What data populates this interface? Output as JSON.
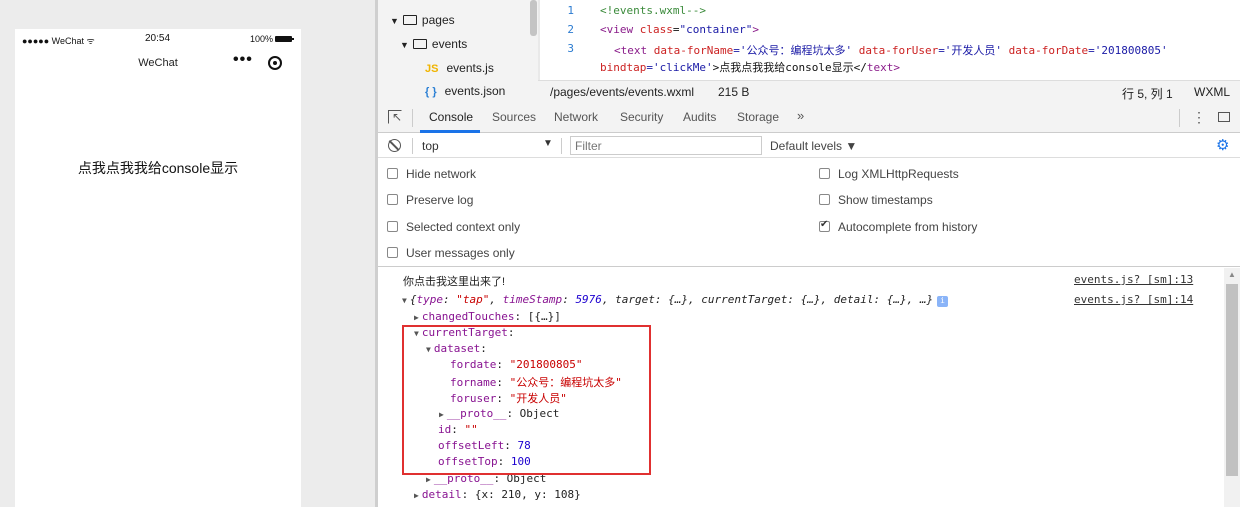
{
  "simulator": {
    "carrier": "●●●●● WeChat ᯤ",
    "time": "20:54",
    "battery": "100%",
    "nav_title": "WeChat",
    "menu_dots": "•••",
    "tap_text": "点我点我我给console显示"
  },
  "file_tree": {
    "items": [
      {
        "label": "pages",
        "type": "folder"
      },
      {
        "label": "events",
        "type": "folder"
      },
      {
        "label": "events.js",
        "type": "js",
        "icon_text": "JS"
      },
      {
        "label": "events.json",
        "type": "json",
        "icon_text": "{ }"
      }
    ]
  },
  "editor": {
    "line_numbers": [
      "1",
      "2",
      "3"
    ],
    "line1": "<!events.wxml-->",
    "line2_open": "<",
    "line2_tag": "view",
    "line2_attr": " class",
    "line2_eq": "=",
    "line2_val": "\"container\"",
    "line2_close": ">",
    "line3_a": "<",
    "line3_tag": "text",
    "line3_attr1": " data-forName",
    "line3_val1": "='公众号：编程坑太多'",
    "line3_attr2": " data-forUser",
    "line3_val2": "='开发人员'",
    "line3_attr3": " data-forDate",
    "line3_val3": "='201800805'",
    "line3b_attr": "bindtap",
    "line3b_val": "='clickMe'",
    "line3b_rest": ">点我点我我给console显示</",
    "line3b_tag": "text",
    "line3b_end": ">",
    "status_path": "/pages/events/events.wxml",
    "status_size": "215 B",
    "status_pos": "行 5, 列 1",
    "status_lang": "WXML"
  },
  "devtools": {
    "tabs": [
      "Console",
      "Sources",
      "Network",
      "Security",
      "Audits",
      "Storage"
    ],
    "more": "»",
    "kebab": "⋮",
    "context": "top",
    "context_arrow": "▼",
    "filter_placeholder": "Filter",
    "levels": "Default levels ▼",
    "gear": "⚙",
    "options_left": [
      {
        "label": "Hide network",
        "checked": false
      },
      {
        "label": "Preserve log",
        "checked": false
      },
      {
        "label": "Selected context only",
        "checked": false
      },
      {
        "label": "User messages only",
        "checked": false
      }
    ],
    "options_right": [
      {
        "label": "Log XMLHttpRequests",
        "checked": false
      },
      {
        "label": "Show timestamps",
        "checked": false
      },
      {
        "label": "Autocomplete from history",
        "checked": true
      }
    ]
  },
  "console": {
    "msg1": "你点击我这里出来了!",
    "msg1_src": "events.js? [sm]:13",
    "obj_src": "events.js? [sm]:14",
    "obj_open": "{",
    "obj_type_key": "type",
    "obj_type_val": "\"tap\"",
    "obj_ts_key": "timeStamp",
    "obj_ts_val": "5976",
    "obj_rest": ", target: {…}, currentTarget: {…}, detail: {…}, …}",
    "info": "i",
    "changedTouches_key": "changedTouches",
    "changedTouches_val": ": [{…}]",
    "currentTarget_key": "currentTarget",
    "dataset_key": "dataset",
    "fordate_key": "fordate",
    "fordate_val": "\"201800805\"",
    "forname_key": "forname",
    "forname_val": "\"公众号：编程坑太多\"",
    "foruser_key": "foruser",
    "foruser_val": "\"开发人员\"",
    "proto_key": "__proto__",
    "proto_val": ": Object",
    "id_key": "id",
    "id_val": "\"\"",
    "offsetLeft_key": "offsetLeft",
    "offsetLeft_val": "78",
    "offsetTop_key": "offsetTop",
    "offsetTop_val": "100",
    "proto2_key": "__proto__",
    "proto2_val": ": Object",
    "detail_key": "detail",
    "detail_val": ": {x: 210, y: 108}"
  },
  "colors": {
    "accent": "#1a73e8",
    "highlight_border": "#e03030",
    "key_purple": "#881391",
    "string_red": "#c80000",
    "number_blue": "#1c00cf"
  }
}
